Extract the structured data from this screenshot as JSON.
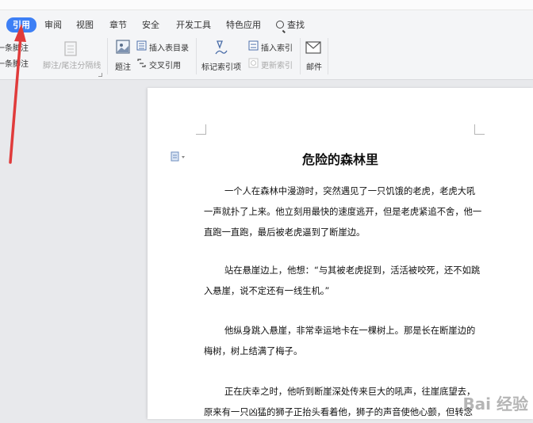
{
  "tabs": [
    {
      "label": "引用",
      "active": true
    },
    {
      "label": "审阅"
    },
    {
      "label": "视图"
    },
    {
      "label": "章节"
    },
    {
      "label": "安全"
    },
    {
      "label": "开发工具"
    },
    {
      "label": "特色应用"
    },
    {
      "label": "查找"
    }
  ],
  "ribbon": {
    "prev_footnote": "上一条脚注",
    "next_footnote": "下一条脚注",
    "separator_line": "脚注/尾注分隔线",
    "caption": "题注",
    "insert_toc": "插入表目录",
    "cross_ref": "交叉引用",
    "mark_index": "标记索引项",
    "insert_index": "插入索引",
    "update_index": "更新索引",
    "mail": "邮件"
  },
  "document": {
    "title": "危险的森林里",
    "paragraphs": [
      "一个人在森林中漫游时，突然遇见了一只饥饿的老虎，老虎大吼一声就扑了上来。他立刻用最快的速度逃开，但是老虎紧追不舍，他一直跑一直跑，最后被老虎逼到了断崖边。",
      "站在悬崖边上，他想：“与其被老虎捉到，活活被咬死，还不如跳入悬崖，说不定还有一线生机。”",
      "他纵身跳入悬崖，非常幸运地卡在一棵树上。那是长在断崖边的梅树，树上结满了梅子。",
      "正在庆幸之时，他听到断崖深处传来巨大的吼声，往崖底望去，原来有一只凶猛的狮子正抬头看着他，狮子的声音使他心颤，但转念"
    ]
  },
  "watermark": "Bai 经验",
  "colors": {
    "accent": "#3d7ff5",
    "arrow": "#e03b3b"
  }
}
